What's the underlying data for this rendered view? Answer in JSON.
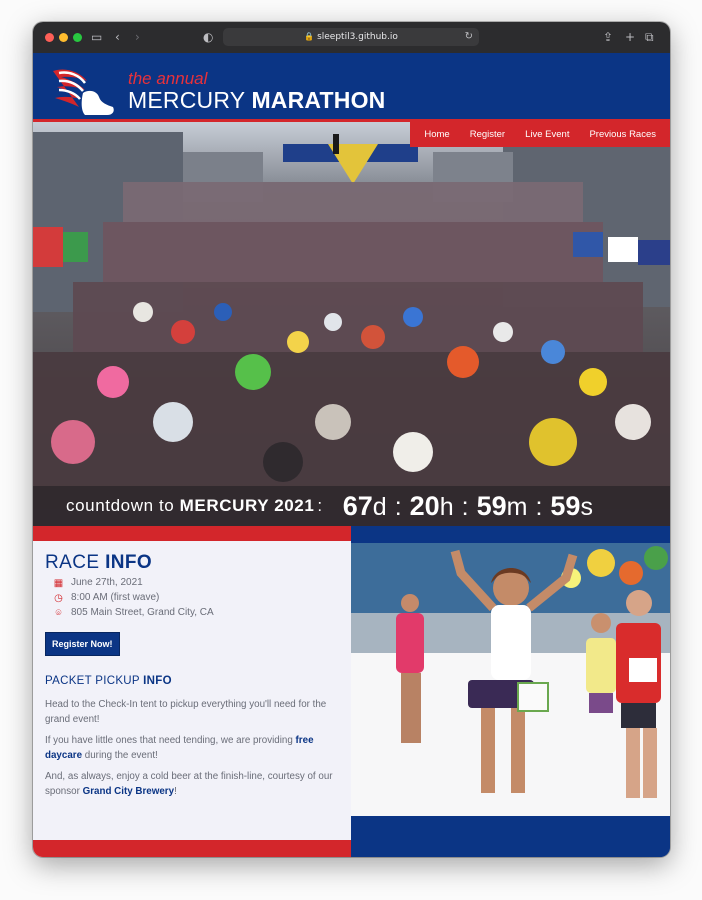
{
  "browser": {
    "url": "sleeptil3.github.io"
  },
  "header": {
    "subtitle": "the annual",
    "title_light": "MERCURY",
    "title_bold": "MARATHON"
  },
  "nav": {
    "items": [
      "Home",
      "Register",
      "Live Event",
      "Previous Races"
    ]
  },
  "countdown": {
    "label_light": "countdown to",
    "label_bold": "MERCURY 2021",
    "colon": ":",
    "days": "67",
    "days_unit": "d",
    "hours": "20",
    "hours_unit": "h",
    "minutes": "59",
    "minutes_unit": "m",
    "seconds": "59",
    "seconds_unit": "s"
  },
  "race_info": {
    "heading_light": "RACE",
    "heading_bold": "INFO",
    "date": "June 27th, 2021",
    "time": "8:00 AM (first wave)",
    "address": "805 Main Street, Grand City, CA",
    "register_label": "Register Now!"
  },
  "packet": {
    "heading_light": "PACKET PICKUP",
    "heading_bold": "INFO",
    "p1": "Head to the Check-In tent to pickup everything you'll need for the grand event!",
    "p2_before": "If you have little ones that need tending, we are providing",
    "p2_link": "free daycare",
    "p2_after": "during the event!",
    "p3_before": "And, as always, enjoy a cold beer at the finish-line, courtesy of our sponsor",
    "p3_link": "Grand City Brewery",
    "p3_after": "!"
  },
  "colors": {
    "navy": "#0b3585",
    "red": "#d3262b",
    "panel": "#f2f2f9"
  }
}
